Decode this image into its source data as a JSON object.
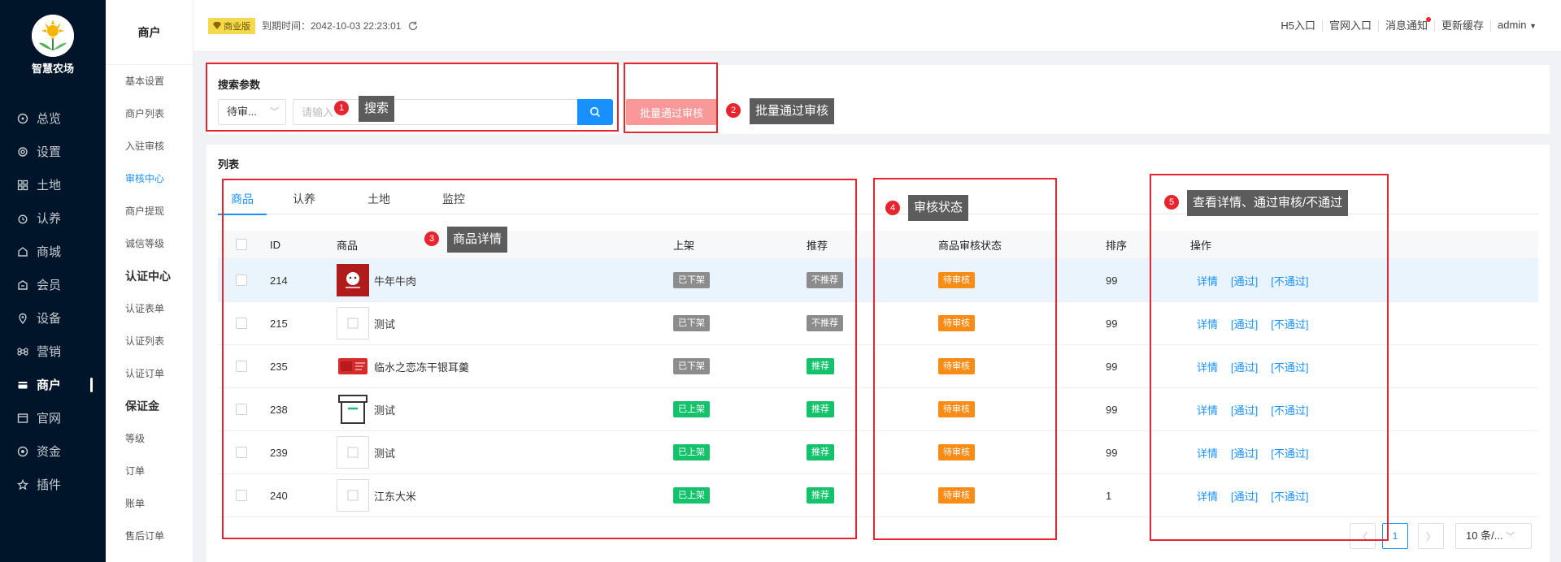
{
  "app": {
    "logo_text": "智慧农场"
  },
  "sidebar": {
    "items": [
      {
        "label": "总览",
        "icon": "dashboard-icon"
      },
      {
        "label": "设置",
        "icon": "gear-icon"
      },
      {
        "label": "土地",
        "icon": "grid-icon"
      },
      {
        "label": "认养",
        "icon": "alarm-icon"
      },
      {
        "label": "商城",
        "icon": "shop-icon"
      },
      {
        "label": "会员",
        "icon": "member-icon"
      },
      {
        "label": "设备",
        "icon": "location-icon"
      },
      {
        "label": "营销",
        "icon": "command-icon"
      },
      {
        "label": "商户",
        "icon": "merchant-icon",
        "active": true
      },
      {
        "label": "官网",
        "icon": "window-icon"
      },
      {
        "label": "资金",
        "icon": "coin-icon"
      },
      {
        "label": "插件",
        "icon": "star-icon"
      }
    ]
  },
  "submenu": {
    "title": "商户",
    "items": [
      {
        "label": "基本设置"
      },
      {
        "label": "商户列表"
      },
      {
        "label": "入驻审核"
      },
      {
        "label": "审核中心",
        "active": true
      },
      {
        "label": "商户提现"
      },
      {
        "label": "诚信等级"
      },
      {
        "label": "认证中心",
        "group": true
      },
      {
        "label": "认证表单"
      },
      {
        "label": "认证列表"
      },
      {
        "label": "认证订单"
      },
      {
        "label": "保证金",
        "group": true
      },
      {
        "label": "等级"
      },
      {
        "label": "订单"
      },
      {
        "label": "账单"
      },
      {
        "label": "售后订单"
      }
    ]
  },
  "header": {
    "badge": "商业版",
    "expire_text": "到期时间：2042-10-03 22:23:01",
    "links": [
      "H5入口",
      "官网入口",
      "消息通知",
      "更新缓存",
      "admin"
    ]
  },
  "search": {
    "title": "搜索参数",
    "select_value": "待审...",
    "placeholder": "请输入",
    "batch_button": "批量通过审核"
  },
  "list": {
    "title": "列表",
    "tabs": [
      "商品",
      "认养",
      "土地",
      "监控"
    ],
    "columns": {
      "id": "ID",
      "goods": "商品",
      "shelf": "上架",
      "recommend": "推荐",
      "status": "商品审核状态",
      "sort": "排序",
      "ops": "操作"
    },
    "rows": [
      {
        "id": "214",
        "name": "牛年牛肉",
        "shelf": "已下架",
        "recommend": "不推荐",
        "status": "待审核",
        "sort": "99",
        "thumb": "red-image"
      },
      {
        "id": "215",
        "name": "测试",
        "shelf": "已下架",
        "recommend": "不推荐",
        "status": "待审核",
        "sort": "99",
        "thumb": "broken-image"
      },
      {
        "id": "235",
        "name": "临水之恋冻干银耳羹",
        "shelf": "已下架",
        "recommend": "推荐",
        "status": "待审核",
        "sort": "99",
        "thumb": "red-box-image"
      },
      {
        "id": "238",
        "name": "测试",
        "shelf": "已上架",
        "recommend": "推荐",
        "status": "待审核",
        "sort": "99",
        "thumb": "box-icon-image"
      },
      {
        "id": "239",
        "name": "测试",
        "shelf": "已上架",
        "recommend": "推荐",
        "status": "待审核",
        "sort": "99",
        "thumb": "broken-image"
      },
      {
        "id": "240",
        "name": "江东大米",
        "shelf": "已上架",
        "recommend": "推荐",
        "status": "待审核",
        "sort": "1",
        "thumb": "broken-image"
      }
    ],
    "actions": {
      "detail": "详情",
      "pass": "[通过]",
      "reject": "[不通过]"
    }
  },
  "pagination": {
    "current": "1",
    "page_size": "10 条/..."
  },
  "annotations": [
    {
      "num": "1",
      "label": "搜索"
    },
    {
      "num": "2",
      "label": "批量通过审核"
    },
    {
      "num": "3",
      "label": "商品详情"
    },
    {
      "num": "4",
      "label": "审核状态"
    },
    {
      "num": "5",
      "label": "查看详情、通过审核/不通过"
    }
  ],
  "colors": {
    "sidebar_bg": "#001529",
    "primary": "#1890ff",
    "danger_light": "#f89898",
    "success": "#13c26b",
    "warning": "#fa8c16",
    "annotation_red": "#e8252f"
  }
}
